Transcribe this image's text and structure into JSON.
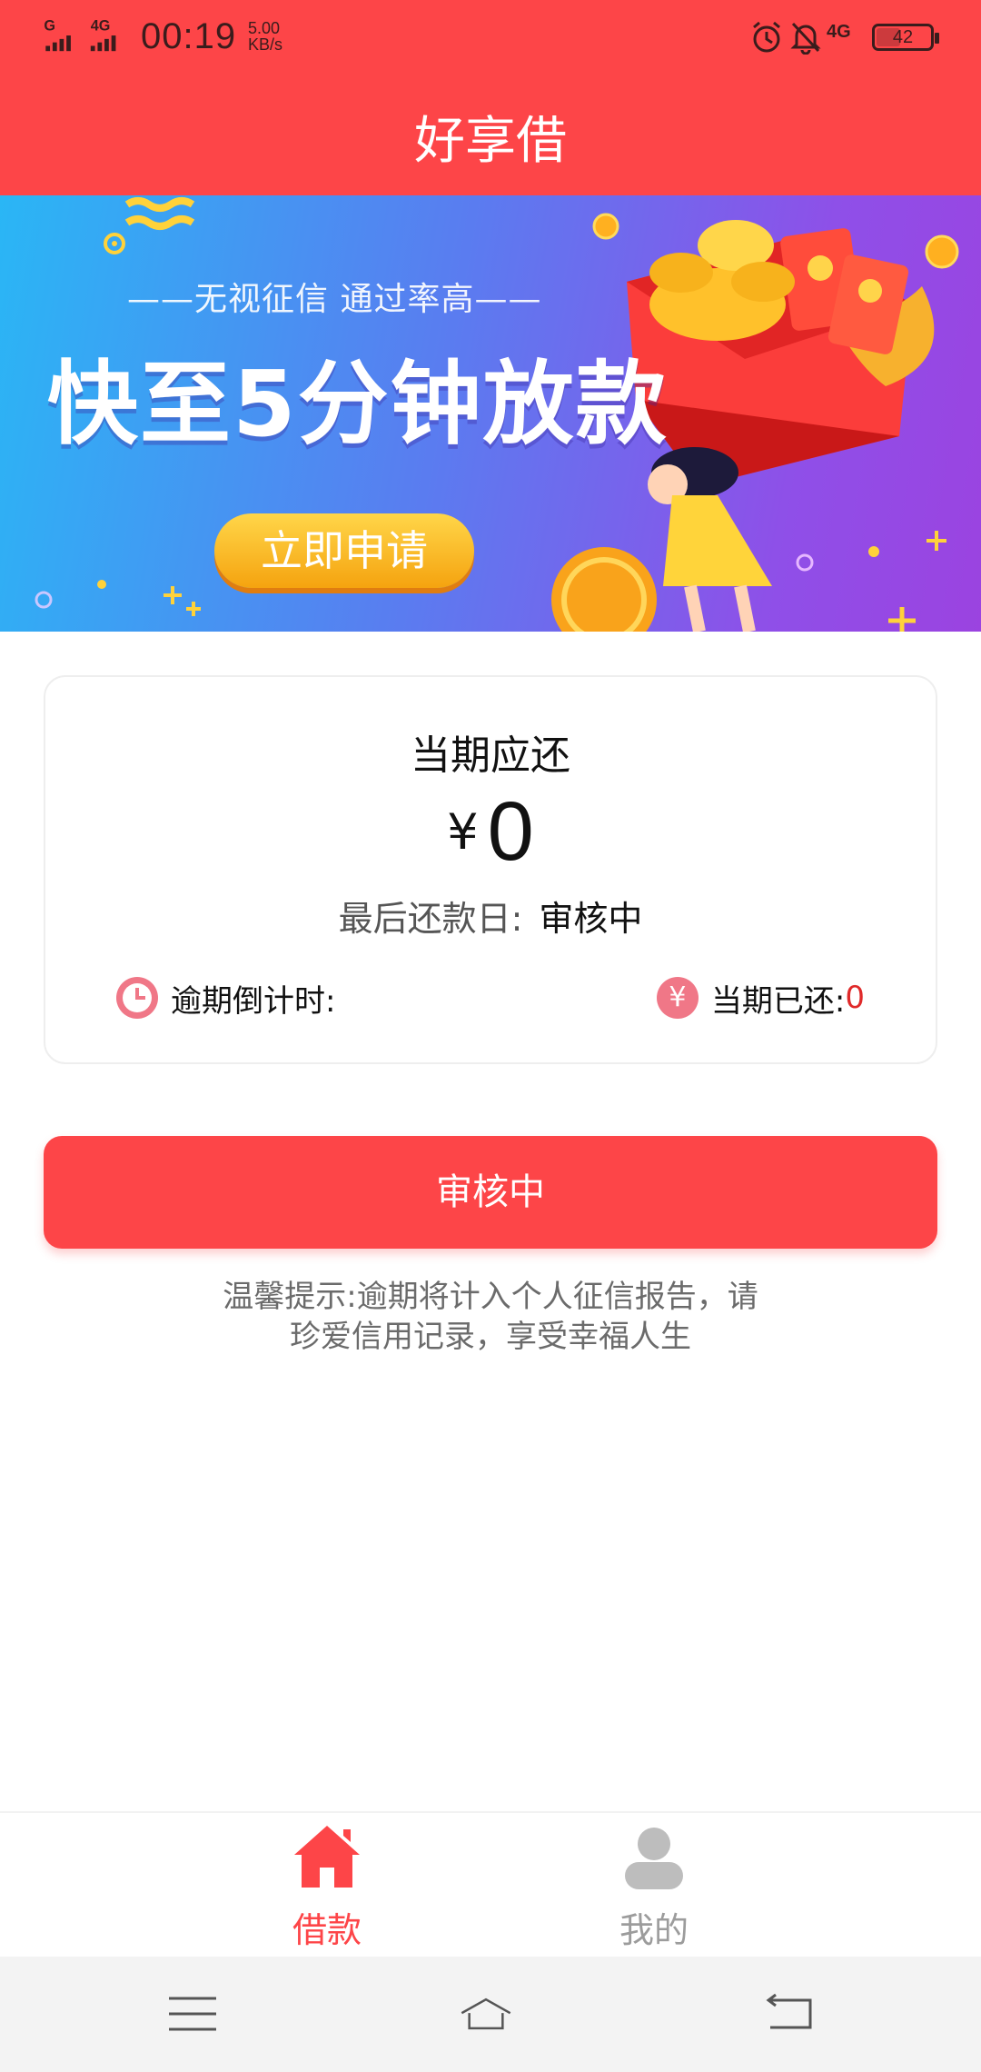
{
  "status_bar": {
    "signal_1": "G",
    "signal_2": "4G",
    "time": "00:19",
    "speed_value": "5.00",
    "speed_unit": "KB/s",
    "network": "4G",
    "battery": "42",
    "icons": [
      "signal-icon",
      "alarm-icon",
      "mute-bell-icon",
      "battery-icon"
    ]
  },
  "header": {
    "title": "好享借"
  },
  "banner": {
    "subtitle": "——无视征信  通过率高——",
    "headline": "快至5分钟放款",
    "cta": "立即申请"
  },
  "card": {
    "title": "当期应还",
    "currency": "¥",
    "amount": "0",
    "due_label": "最后还款日:",
    "due_status": "审核中",
    "countdown_label": "逾期倒计时:",
    "paid_label": "当期已还:",
    "paid_value": "0",
    "paid_icon_glyph": "¥"
  },
  "action": {
    "label": "审核中"
  },
  "tip": {
    "line1": "温馨提示:逾期将计入个人征信报告，请",
    "line2": "珍爱信用记录，享受幸福人生"
  },
  "tabs": [
    {
      "label": "借款",
      "icon": "home-icon",
      "active": true
    },
    {
      "label": "我的",
      "icon": "user-icon",
      "active": false
    }
  ],
  "colors": {
    "brand": "#fd4548",
    "inactive": "#9c9c9c",
    "paid": "#e02a2a"
  }
}
